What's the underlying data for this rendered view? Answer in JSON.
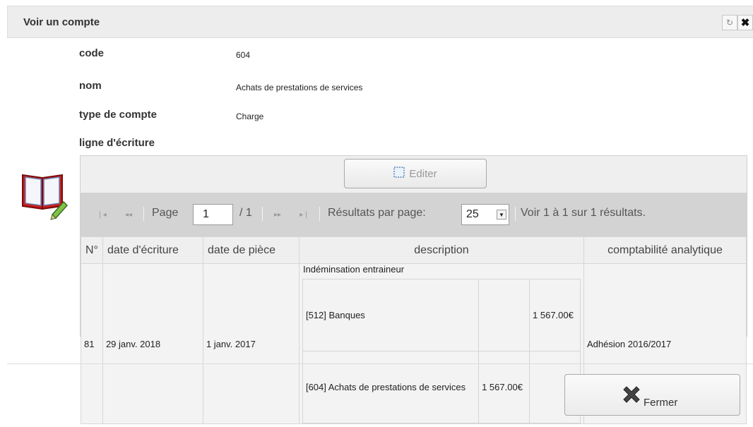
{
  "dialog": {
    "title": "Voir un compte",
    "refresh_icon": "refresh-icon",
    "close_icon": "close-icon"
  },
  "fields": {
    "code": {
      "label": "code",
      "value": "604"
    },
    "nom": {
      "label": "nom",
      "value": "Achats de prestations de services"
    },
    "type": {
      "label": "type de compte",
      "value": "Charge"
    },
    "lignes_label": "ligne d'écriture"
  },
  "grid": {
    "edit_label": "Editer",
    "pager": {
      "page_label": "Page",
      "page_value": "1",
      "page_total": "/ 1",
      "per_page_label": "Résultats par page:",
      "per_page_value": "25",
      "summary": "Voir 1 à 1 sur 1 résultats."
    },
    "columns": [
      "N°",
      "date d'écriture",
      "date de pièce",
      "description",
      "comptabilité analytique"
    ],
    "rows": [
      {
        "num": "81",
        "date_ecriture": "29 janv. 2018",
        "date_piece": "1 janv. 2017",
        "description": "Indéminsation entraineur",
        "sublines": [
          {
            "account": "[512] Banques",
            "debit": "",
            "credit": "1 567.00€"
          },
          {
            "account": "[604] Achats de prestations de services",
            "debit": "1 567.00€",
            "credit": ""
          }
        ],
        "analytique": "Adhésion 2016/2017"
      }
    ]
  },
  "footer": {
    "close_label": "Fermer"
  }
}
